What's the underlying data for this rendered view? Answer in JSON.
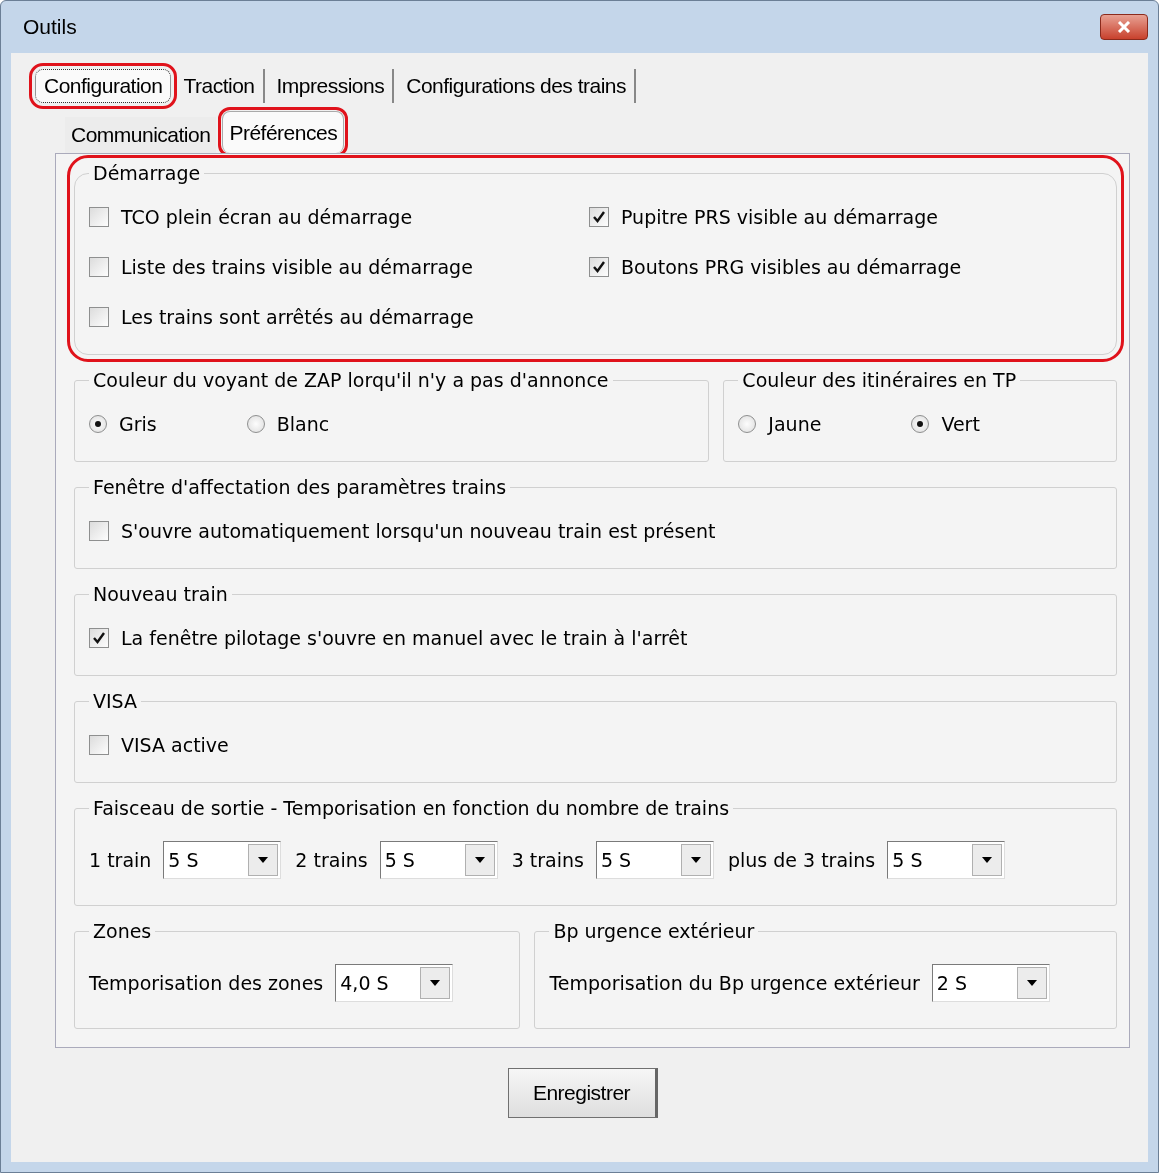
{
  "window": {
    "title": "Outils"
  },
  "tabs": [
    {
      "label": "Configuration",
      "selected": true,
      "highlighted": true
    },
    {
      "label": "Traction",
      "selected": false,
      "highlighted": false
    },
    {
      "label": "Impressions",
      "selected": false,
      "highlighted": false
    },
    {
      "label": "Configurations des trains",
      "selected": false,
      "highlighted": false
    }
  ],
  "subtabs": [
    {
      "label": "Communication",
      "selected": false,
      "highlighted": false
    },
    {
      "label": "Préférences",
      "selected": true,
      "highlighted": true
    }
  ],
  "rows": [
    [
      {
        "title": "Démarrage",
        "highlighted": true,
        "kind": "grid",
        "items": [
          {
            "kind": "checkbox",
            "label": "TCO plein écran au démarrage",
            "checked": false
          },
          {
            "kind": "checkbox",
            "label": "Pupitre PRS visible au démarrage",
            "checked": true
          },
          {
            "kind": "checkbox",
            "label": "Liste des trains visible au démarrage",
            "checked": false
          },
          {
            "kind": "checkbox",
            "label": "Boutons PRG visibles au démarrage",
            "checked": true
          },
          {
            "kind": "checkbox",
            "label": "Les trains sont arrêtés au démarrage",
            "checked": false
          }
        ]
      }
    ],
    [
      {
        "title": "Couleur du voyant de ZAP lorqu'il n'y a pas d'annonce",
        "highlighted": false,
        "kind": "row",
        "items": [
          {
            "kind": "radio",
            "label": "Gris",
            "selected": true
          },
          {
            "kind": "radio",
            "label": "Blanc",
            "selected": false
          }
        ]
      },
      {
        "title": "Couleur des itinéraires en TP",
        "highlighted": false,
        "kind": "row",
        "items": [
          {
            "kind": "radio",
            "label": "Jaune",
            "selected": false
          },
          {
            "kind": "radio",
            "label": "Vert",
            "selected": true
          }
        ]
      }
    ],
    [
      {
        "title": "Fenêtre d'affectation des paramètres trains",
        "highlighted": false,
        "kind": "row",
        "items": [
          {
            "kind": "checkbox",
            "label": "S'ouvre automatiquement lorsqu'un nouveau train est présent",
            "checked": false
          }
        ]
      }
    ],
    [
      {
        "title": "Nouveau train",
        "highlighted": false,
        "kind": "row",
        "items": [
          {
            "kind": "checkbox",
            "label": "La fenêtre pilotage s'ouvre en manuel avec le train à l'arrêt",
            "checked": true
          }
        ]
      }
    ],
    [
      {
        "title": "VISA",
        "highlighted": false,
        "kind": "row",
        "items": [
          {
            "kind": "checkbox",
            "label": "VISA active",
            "checked": false
          }
        ]
      }
    ],
    [
      {
        "title": "Faisceau de sortie - Temporisation en fonction du nombre de trains",
        "highlighted": false,
        "kind": "row",
        "items": [
          {
            "kind": "combo",
            "label": "1 train",
            "value": "5 S"
          },
          {
            "kind": "combo",
            "label": "2 trains",
            "value": "5 S"
          },
          {
            "kind": "combo",
            "label": "3 trains",
            "value": "5 S"
          },
          {
            "kind": "combo",
            "label": "plus de 3 trains",
            "value": "5 S"
          }
        ]
      }
    ],
    [
      {
        "title": "Zones",
        "highlighted": false,
        "kind": "row",
        "items": [
          {
            "kind": "combo",
            "label": "Temporisation des zones",
            "value": "4,0 S"
          }
        ]
      },
      {
        "title": "Bp urgence extérieur",
        "highlighted": false,
        "kind": "row",
        "items": [
          {
            "kind": "combo",
            "label": "Temporisation du Bp urgence extérieur",
            "value": "2 S"
          }
        ]
      }
    ]
  ],
  "save_button": "Enregistrer"
}
